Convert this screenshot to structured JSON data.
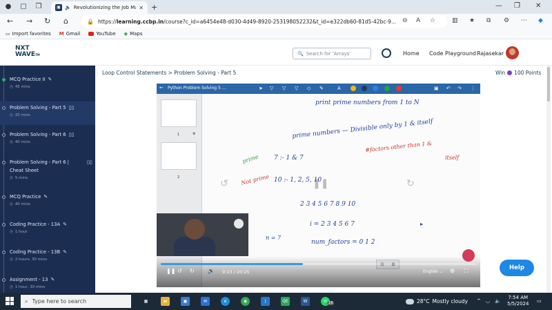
{
  "browser": {
    "tab_title": "Revolutionizing the Job Ma",
    "url_host": "learning.ccbp.in",
    "url_path": "/course?c_id=a6454e48-d030-4d49-8920-253198052232&t_id=e322db60-81d5-42bc-9...",
    "favorites": [
      {
        "label": "Import favorites"
      },
      {
        "label": "Gmail"
      },
      {
        "label": "YouTube"
      },
      {
        "label": "Maps"
      }
    ]
  },
  "header": {
    "logo_top": "NXT",
    "logo_bottom": "WAVE",
    "logo_tm": "TM",
    "search_placeholder": "Search for 'Arrays'",
    "nav": {
      "home": "Home",
      "playground": "Code Playground"
    },
    "username": "Rajasekar"
  },
  "sidebar": {
    "items": [
      {
        "name": "MCQ Practice II",
        "time": "45 mins"
      },
      {
        "name": "Problem Solving - Part 5",
        "time": "20 mins"
      },
      {
        "name": "Problem Solving - Part 6",
        "time": "40 mins"
      },
      {
        "name": "Problem Solving - Part 6 |",
        "name2": "Cheat Sheet",
        "time": "5 mins"
      },
      {
        "name": "MCQ Practice",
        "time": "40 mins"
      },
      {
        "name": "Coding Practice - 13A",
        "time": "1 hour"
      },
      {
        "name": "Coding Practice - 13B",
        "time": "2 hours, 30 mins"
      },
      {
        "name": "Assignment - 13",
        "time": "1 hour, 30 mins"
      }
    ]
  },
  "content": {
    "breadcrumb": "Loop Control Statements > Problem Solving - Part 5",
    "points": {
      "prefix": "Win",
      "value": "100 Points"
    }
  },
  "video": {
    "title": "Python Problem Solving 5 ...",
    "thumb1": "1",
    "thumb2": "2",
    "current_time": "9:13",
    "duration": "20:25",
    "progress": 0.45,
    "language": "English",
    "board": {
      "line1": "print prime numbers from  1 to N",
      "line2": "prime numbers — Divisible only by  1 & itself",
      "prime_label": "prime",
      "prime_example": "7  :-   1 & 7",
      "factors_note": "#factors other than 1 &",
      "itself": "itself",
      "notprime_label": "Not prime",
      "notprime_example": "10  :-   1, 2, 5, 10",
      "seq1": "2   3   4   5   6   7   8   9   10",
      "seq2": "i =  2   3   4   5   6   7",
      "n_eq": "n = 7",
      "num_factors": "num_factors = 0  1  2"
    },
    "colors": {
      "yellow": "#f2b51c",
      "navy": "#1f3a66",
      "blue": "#2f7ee6",
      "green": "#25a244",
      "red": "#e53935"
    }
  },
  "help_label": "Help",
  "taskbar": {
    "search_placeholder": "Type here to search",
    "whatsapp_badge": "18",
    "temp": "28°C",
    "weather": "Mostly cloudy",
    "time": "7:54 AM",
    "date": "5/5/2024"
  }
}
